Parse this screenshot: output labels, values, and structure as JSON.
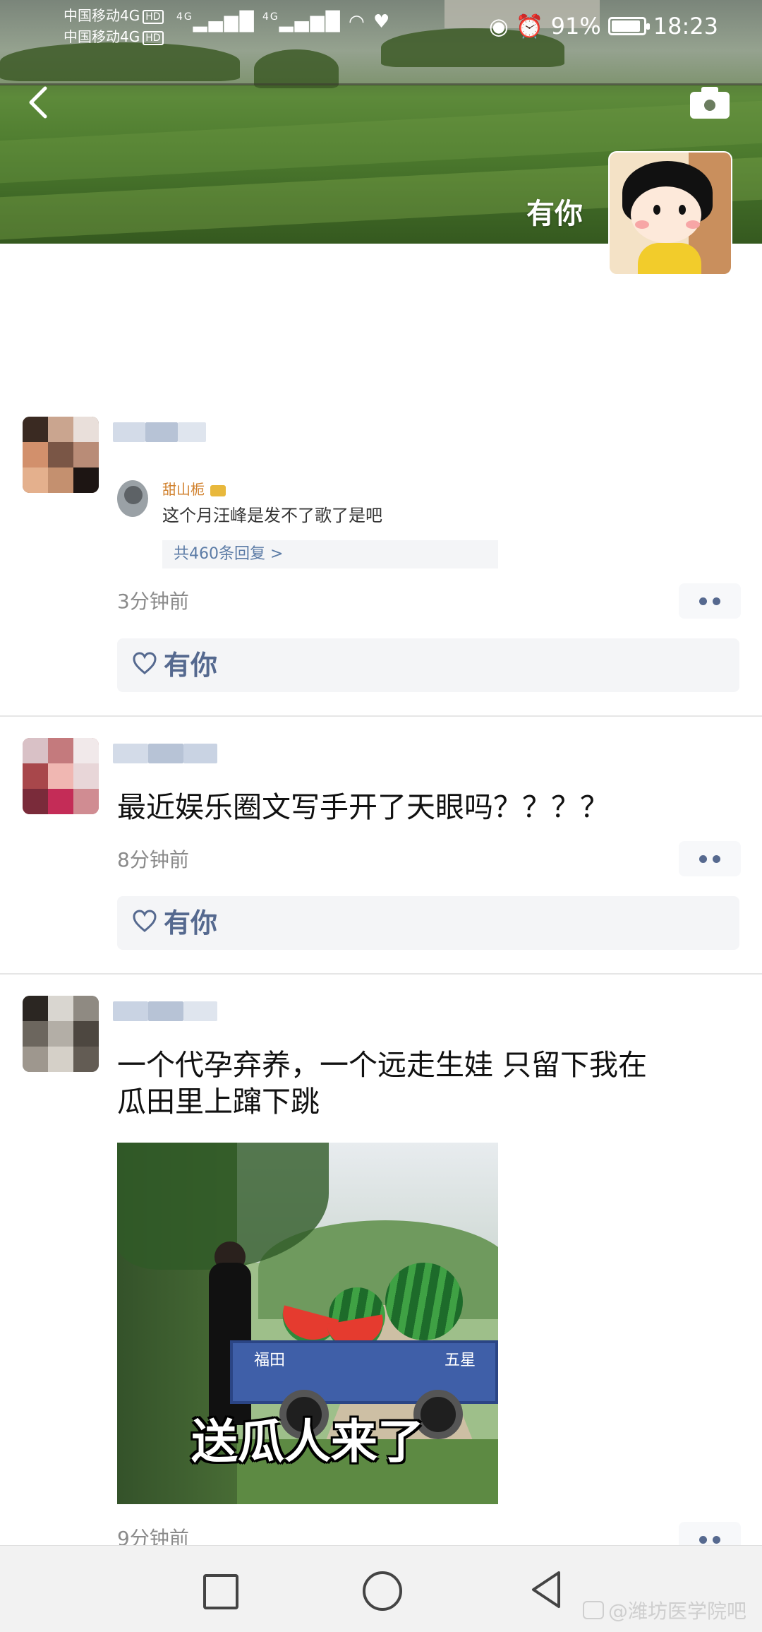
{
  "status_bar": {
    "carrier_1": "中国移动4G",
    "carrier_2": "中国移动4G",
    "hd_1": "HD",
    "hd_2": "HD",
    "network_1": "4G",
    "network_2": "4G",
    "battery_percent": "91%",
    "battery_level": 0.91,
    "time": "18:23"
  },
  "header": {
    "cover_name": "有你",
    "back_icon": "chevron-left-icon",
    "camera_icon": "camera-icon"
  },
  "posts": [
    {
      "comment_preview": {
        "user": "甜山栀",
        "text": "这个月汪峰是发不了歌了是吧",
        "reply_count": "共460条回复 >"
      },
      "time": "3分钟前",
      "like_name": "有你"
    },
    {
      "text": "最近娱乐圈文写手开了天眼吗？？？？",
      "time": "8分钟前",
      "like_name": "有你"
    },
    {
      "text_line_1": "一个代孕弃养，一个远走生娃 只留下我在",
      "text_line_2": "瓜田里上蹿下跳",
      "image": {
        "caption": "送瓜人来了",
        "truck_text_1": "福田",
        "truck_text_2": "五星"
      },
      "time": "9分钟前"
    }
  ],
  "nav": {
    "recent_icon": "square-icon",
    "home_icon": "circle-icon",
    "back_icon": "triangle-back-icon"
  },
  "watermark": "@潍坊医学院吧"
}
